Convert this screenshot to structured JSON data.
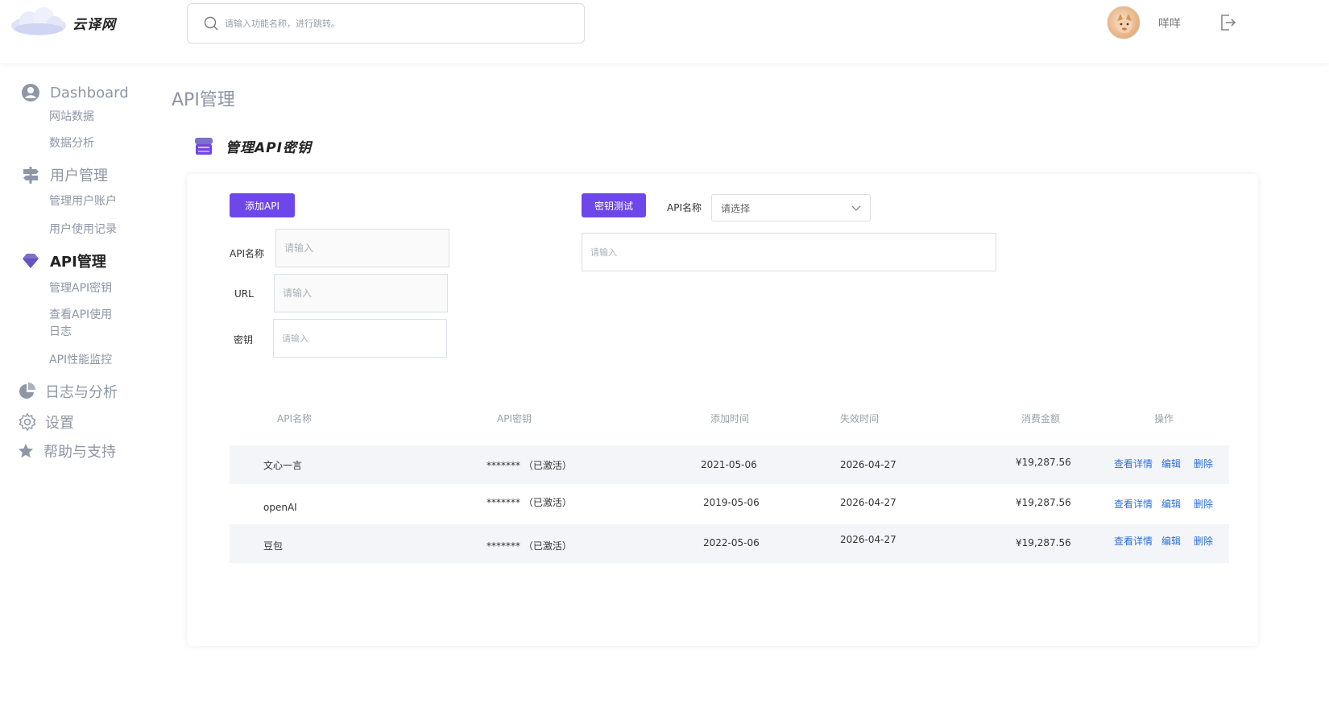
{
  "header": {
    "logo_text": "云译网",
    "search_placeholder": "请输入功能名称，进行跳转。",
    "username": "咩咩"
  },
  "sidebar": {
    "groups": [
      {
        "label": "Dashboard",
        "icon": "user-circle-icon",
        "subs": [
          "网站数据",
          "数据分析"
        ]
      },
      {
        "label": "用户管理",
        "icon": "signpost-icon",
        "subs": [
          "管理用户账户",
          "用户使用记录"
        ]
      },
      {
        "label": "API管理",
        "icon": "diamond-icon",
        "subs": [
          "管理API密钥",
          "查看API使用日志",
          "API性能监控"
        ]
      },
      {
        "label": "日志与分析",
        "icon": "pie-chart-icon"
      },
      {
        "label": "设置",
        "icon": "gear-icon"
      },
      {
        "label": "帮助与支持",
        "icon": "star-icon"
      }
    ],
    "api_log_line1": "查看API使用",
    "api_log_line2": "日志"
  },
  "page": {
    "title": "API管理",
    "section_title": "管理API密钥"
  },
  "form": {
    "add_button": "添加API",
    "test_button": "密钥测试",
    "api_name_label": "API名称",
    "url_label": "URL",
    "key_label": "密钥",
    "input_placeholder": "请输入",
    "select_label": "API名称",
    "select_value": "请选择",
    "test_placeholder": "请输入"
  },
  "table": {
    "headers": [
      "API名称",
      "API密钥",
      "添加时间",
      "失效时间",
      "消费金额",
      "操作"
    ],
    "rows": [
      {
        "name": "文心一言",
        "key": "******* （已激活）",
        "added": "2021-05-06",
        "expires": "2026-04-27",
        "amount": "¥19,287.56"
      },
      {
        "name": "openAI",
        "key": "******* （已激活）",
        "added": "2019-05-06",
        "expires": "2026-04-27",
        "amount": "¥19,287.56"
      },
      {
        "name": "豆包",
        "key": "******* （已激活）",
        "added": "2022-05-06",
        "expires": "2026-04-27",
        "amount": "¥19,287.56"
      }
    ],
    "actions": {
      "view": "查看详情",
      "edit": "编辑",
      "delete": "删除"
    }
  },
  "colors": {
    "accent": "#6e47ea",
    "link": "#2e6fd6",
    "muted": "#8f96a6"
  }
}
